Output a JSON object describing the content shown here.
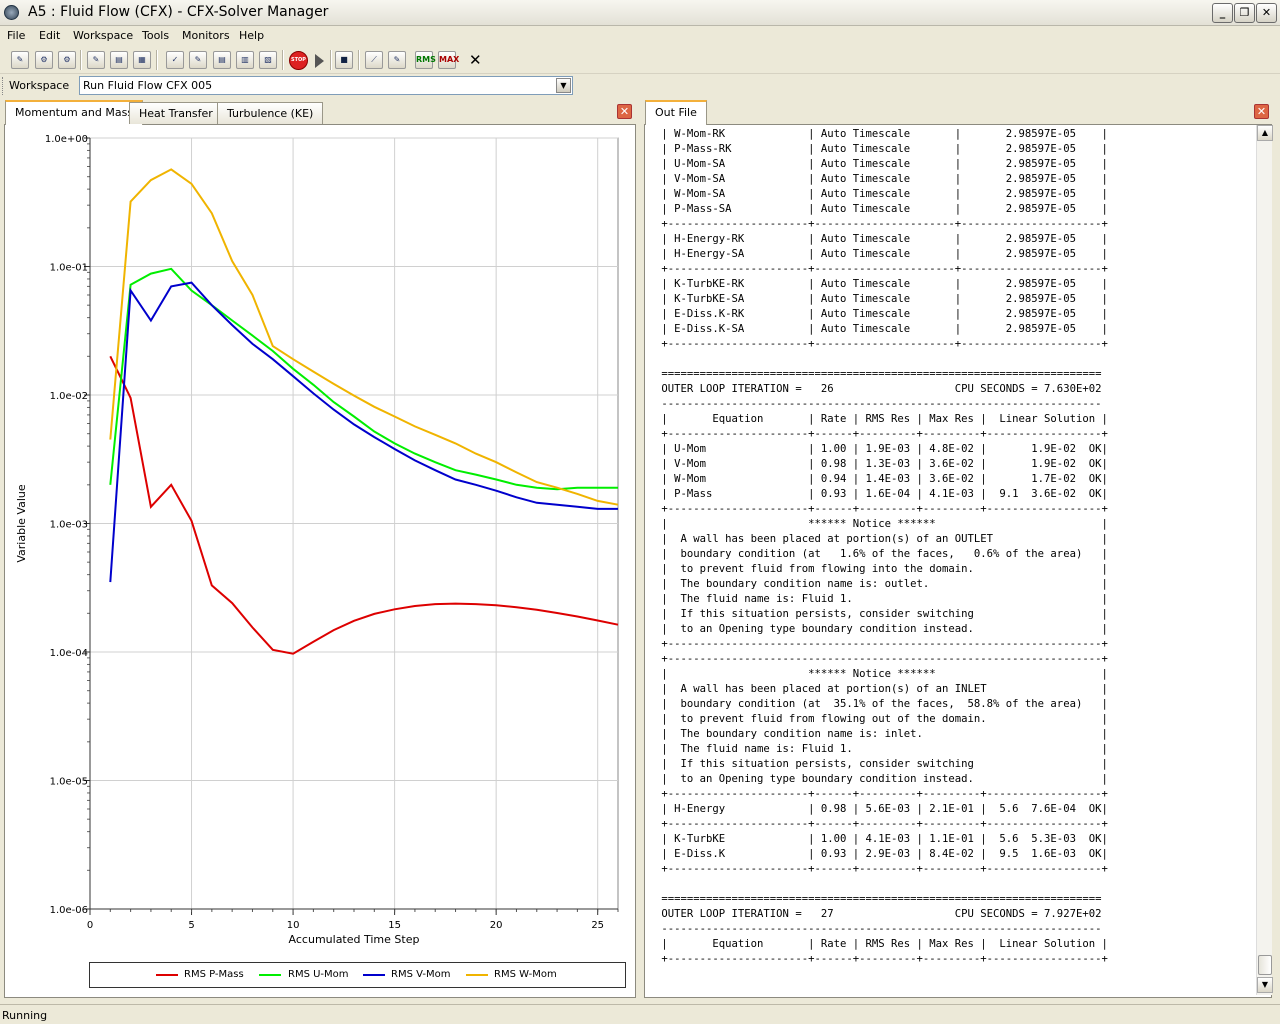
{
  "window": {
    "title": "A5 : Fluid Flow (CFX) - CFX-Solver Manager"
  },
  "menu": [
    "File",
    "Edit",
    "Workspace",
    "Tools",
    "Monitors",
    "Help"
  ],
  "toolbar": {
    "stop_label": "STOP",
    "rms_label": "RMS",
    "max_label": "MAX",
    "close_glyph": "✕"
  },
  "workspace": {
    "label": "Workspace",
    "value": "Run Fluid Flow CFX 005"
  },
  "left_tabs": [
    "Momentum and Mass",
    "Heat Transfer",
    "Turbulence (KE)"
  ],
  "right_tabs": [
    "Out File"
  ],
  "colors": {
    "p_mass": "#dd0000",
    "u_mom": "#00ee00",
    "v_mom": "#0000cc",
    "w_mom": "#f0b400"
  },
  "chart_data": {
    "type": "line",
    "xlabel": "Accumulated Time Step",
    "ylabel": "Variable Value",
    "yscale": "log",
    "ylim": [
      1e-06,
      1
    ],
    "xlim": [
      0,
      26
    ],
    "xticks": [
      "0",
      "5",
      "10",
      "15",
      "20",
      "25"
    ],
    "yticks": [
      "1.0e-06",
      "1.0e-05",
      "1.0e-04",
      "1.0e-03",
      "1.0e-02",
      "1.0e-01",
      "1.0e+00"
    ],
    "x": [
      1,
      2,
      3,
      4,
      5,
      6,
      7,
      8,
      9,
      10,
      11,
      12,
      13,
      14,
      15,
      16,
      17,
      18,
      19,
      20,
      21,
      22,
      23,
      24,
      25,
      26
    ],
    "series": [
      {
        "name": "RMS P-Mass",
        "color": "#dd0000",
        "values": [
          0.02,
          0.0095,
          0.00135,
          0.002,
          0.00105,
          0.00033,
          0.00024,
          0.000155,
          0.000104,
          9.7e-05,
          0.00012,
          0.000148,
          0.000175,
          0.000198,
          0.000215,
          0.000228,
          0.000236,
          0.000238,
          0.000236,
          0.000231,
          0.000223,
          0.000213,
          0.000201,
          0.000189,
          0.000176,
          0.000163
        ]
      },
      {
        "name": "RMS U-Mom",
        "color": "#00ee00",
        "values": [
          0.002,
          0.072,
          0.088,
          0.096,
          0.065,
          0.05,
          0.038,
          0.029,
          0.022,
          0.016,
          0.012,
          0.0088,
          0.0068,
          0.0052,
          0.0042,
          0.0035,
          0.003,
          0.0026,
          0.0024,
          0.0022,
          0.002,
          0.0019,
          0.00185,
          0.0019,
          0.0019,
          0.0019
        ]
      },
      {
        "name": "RMS V-Mom",
        "color": "#0000cc",
        "values": [
          0.00035,
          0.065,
          0.038,
          0.07,
          0.075,
          0.05,
          0.035,
          0.025,
          0.019,
          0.014,
          0.0103,
          0.0077,
          0.0059,
          0.0047,
          0.0038,
          0.0031,
          0.0026,
          0.0022,
          0.002,
          0.0018,
          0.0016,
          0.00145,
          0.0014,
          0.00135,
          0.0013,
          0.0013
        ]
      },
      {
        "name": "RMS W-Mom",
        "color": "#f0b400",
        "values": [
          0.0045,
          0.32,
          0.47,
          0.57,
          0.44,
          0.26,
          0.11,
          0.06,
          0.024,
          0.019,
          0.0152,
          0.0122,
          0.0099,
          0.0081,
          0.0068,
          0.0057,
          0.0049,
          0.0042,
          0.0035,
          0.003,
          0.0025,
          0.0021,
          0.0019,
          0.0017,
          0.0015,
          0.0014
        ]
      }
    ]
  },
  "legend": [
    "RMS P-Mass",
    "RMS U-Mom",
    "RMS V-Mom",
    "RMS W-Mom"
  ],
  "outfile_lines": [
    " | W-Mom-RK             | Auto Timescale       |       2.98597E-05    |",
    " | P-Mass-RK            | Auto Timescale       |       2.98597E-05    |",
    " | U-Mom-SA             | Auto Timescale       |       2.98597E-05    |",
    " | V-Mom-SA             | Auto Timescale       |       2.98597E-05    |",
    " | W-Mom-SA             | Auto Timescale       |       2.98597E-05    |",
    " | P-Mass-SA            | Auto Timescale       |       2.98597E-05    |",
    " +----------------------+----------------------+----------------------+",
    " | H-Energy-RK          | Auto Timescale       |       2.98597E-05    |",
    " | H-Energy-SA          | Auto Timescale       |       2.98597E-05    |",
    " +----------------------+----------------------+----------------------+",
    " | K-TurbKE-RK          | Auto Timescale       |       2.98597E-05    |",
    " | K-TurbKE-SA          | Auto Timescale       |       2.98597E-05    |",
    " | E-Diss.K-RK          | Auto Timescale       |       2.98597E-05    |",
    " | E-Diss.K-SA          | Auto Timescale       |       2.98597E-05    |",
    " +----------------------+----------------------+----------------------+",
    "",
    " =====================================================================",
    " OUTER LOOP ITERATION =   26                   CPU SECONDS = 7.630E+02",
    " ---------------------------------------------------------------------",
    " |       Equation       | Rate | RMS Res | Max Res |  Linear Solution |",
    " +----------------------+------+---------+---------+------------------+",
    " | U-Mom                | 1.00 | 1.9E-03 | 4.8E-02 |       1.9E-02  OK|",
    " | V-Mom                | 0.98 | 1.3E-03 | 3.6E-02 |       1.9E-02  OK|",
    " | W-Mom                | 0.94 | 1.4E-03 | 3.6E-02 |       1.7E-02  OK|",
    " | P-Mass               | 0.93 | 1.6E-04 | 4.1E-03 |  9.1  3.6E-02  OK|",
    " +----------------------+------+---------+---------+------------------+",
    " |                      ****** Notice ******                          |",
    " |  A wall has been placed at portion(s) of an OUTLET                 |",
    " |  boundary condition (at   1.6% of the faces,   0.6% of the area)   |",
    " |  to prevent fluid from flowing into the domain.                    |",
    " |  The boundary condition name is: outlet.                           |",
    " |  The fluid name is: Fluid 1.                                       |",
    " |  If this situation persists, consider switching                    |",
    " |  to an Opening type boundary condition instead.                    |",
    " +--------------------------------------------------------------------+",
    " +--------------------------------------------------------------------+",
    " |                      ****** Notice ******                          |",
    " |  A wall has been placed at portion(s) of an INLET                  |",
    " |  boundary condition (at  35.1% of the faces,  58.8% of the area)   |",
    " |  to prevent fluid from flowing out of the domain.                  |",
    " |  The boundary condition name is: inlet.                            |",
    " |  The fluid name is: Fluid 1.                                       |",
    " |  If this situation persists, consider switching                    |",
    " |  to an Opening type boundary condition instead.                    |",
    " +----------------------+------+---------+---------+------------------+",
    " | H-Energy             | 0.98 | 5.6E-03 | 2.1E-01 |  5.6  7.6E-04  OK|",
    " +----------------------+------+---------+---------+------------------+",
    " | K-TurbKE             | 1.00 | 4.1E-03 | 1.1E-01 |  5.6  5.3E-03  OK|",
    " | E-Diss.K             | 0.93 | 2.9E-03 | 8.4E-02 |  9.5  1.6E-03  OK|",
    " +----------------------+------+---------+---------+------------------+",
    "",
    " =====================================================================",
    " OUTER LOOP ITERATION =   27                   CPU SECONDS = 7.927E+02",
    " ---------------------------------------------------------------------",
    " |       Equation       | Rate | RMS Res | Max Res |  Linear Solution |",
    " +----------------------+------+---------+---------+------------------+"
  ],
  "status": "Running"
}
